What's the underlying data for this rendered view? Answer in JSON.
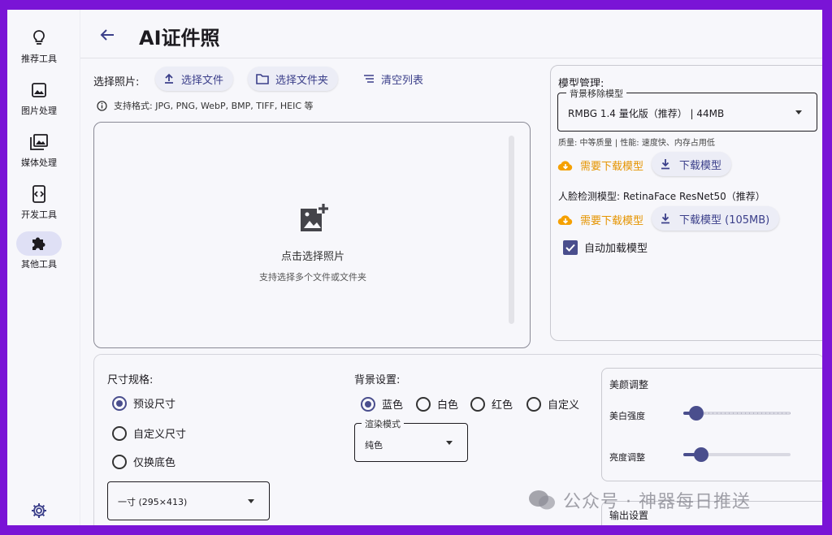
{
  "sidebar": {
    "items": [
      {
        "label": "推荐工具",
        "icon": "lightbulb-icon",
        "active": false
      },
      {
        "label": "图片处理",
        "icon": "image-icon",
        "active": false
      },
      {
        "label": "媒体处理",
        "icon": "photo-library-icon",
        "active": false
      },
      {
        "label": "开发工具",
        "icon": "code-icon",
        "active": false
      },
      {
        "label": "其他工具",
        "icon": "puzzle-icon",
        "active": true
      }
    ],
    "settings_icon": "gear-icon"
  },
  "header": {
    "title": "AI证件照",
    "back_icon": "arrow-left-icon"
  },
  "select_photo": {
    "label": "选择照片:",
    "select_file": "选择文件",
    "select_folder": "选择文件夹",
    "clear_list": "清空列表",
    "formats_hint": "支持格式: JPG, PNG, WebP, BMP, TIFF, HEIC 等"
  },
  "dropzone": {
    "main_text": "点击选择照片",
    "sub_text": "支持选择多个文件或文件夹"
  },
  "model_management": {
    "title": "模型管理:",
    "bg_model_label": "背景移除模型",
    "bg_model_value": "RMBG 1.4 量化版（推荐） | 44MB",
    "bg_model_meta": "质量: 中等质量 | 性能: 速度快、内存占用低",
    "need_download": "需要下载模型",
    "download_button": "下载模型",
    "face_model_label": "人脸检测模型: RetinaFace ResNet50（推荐）",
    "need_download_2": "需要下载模型",
    "download_button_2": "下载模型 (105MB)",
    "auto_load_label": "自动加载模型",
    "auto_load_checked": true,
    "warning_color": "#e59400",
    "accent_color": "#4a4e8d"
  },
  "size_spec": {
    "title": "尺寸规格:",
    "options": [
      "预设尺寸",
      "自定义尺寸",
      "仅换底色"
    ],
    "selected_index": 0,
    "preset_value": "一寸 (295×413)"
  },
  "background": {
    "title": "背景设置:",
    "options": [
      "蓝色",
      "白色",
      "红色",
      "自定义"
    ],
    "selected_index": 0,
    "render_mode_label": "渲染模式",
    "render_mode_value": "纯色"
  },
  "beauty": {
    "title": "美颜调整",
    "whitening_label": "美白强度",
    "whitening_value": 0.12,
    "brightness_label": "亮度调整",
    "brightness_value": 0.17
  },
  "output": {
    "title": "输出设置"
  },
  "watermark": {
    "text": "公众号 · 神器每日推送"
  }
}
